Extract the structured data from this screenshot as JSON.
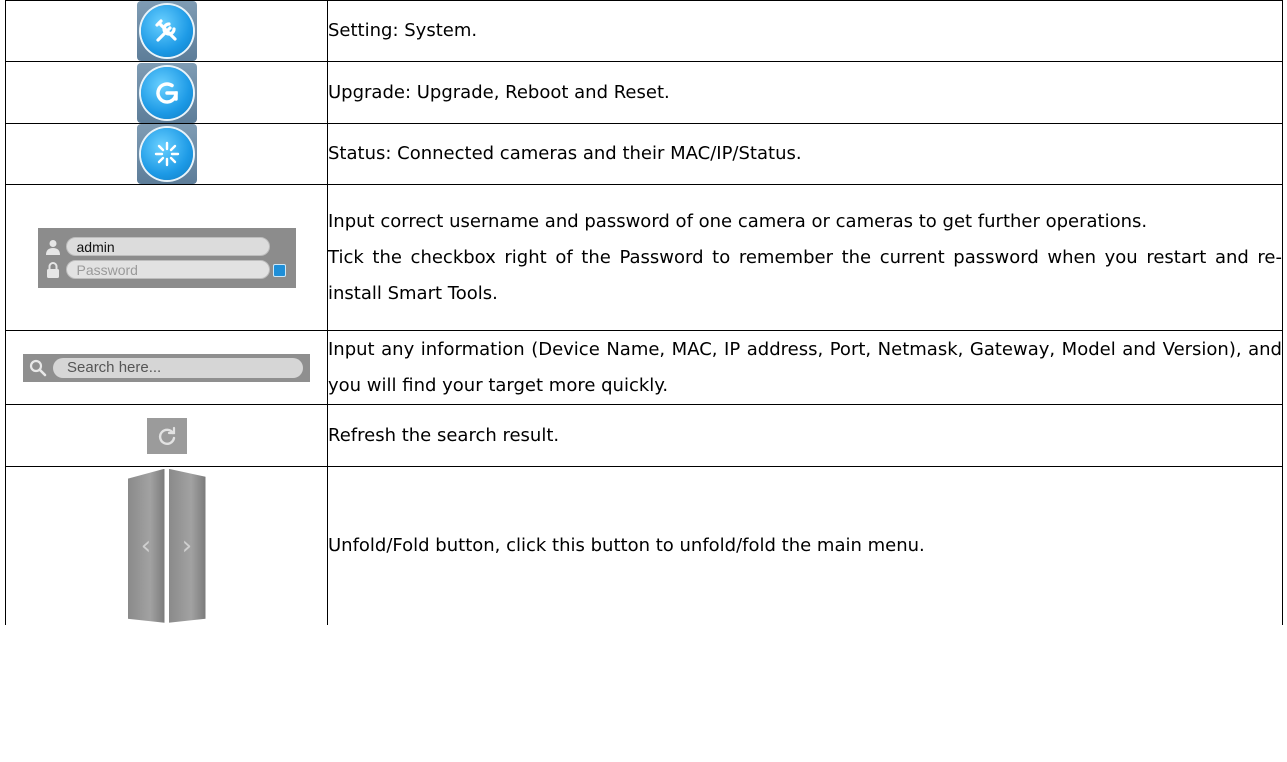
{
  "rows": [
    {
      "icon": "tools-icon",
      "text": "Setting: System."
    },
    {
      "icon": "upgrade-icon",
      "text": "Upgrade: Upgrade, Reboot and Reset."
    },
    {
      "icon": "status-icon",
      "text": "Status: Connected cameras and their MAC/IP/Status."
    },
    {
      "icon": "login-widget",
      "username_value": "admin",
      "password_placeholder": "Password",
      "text_line1": "Input correct username and password of one camera or cameras to get further operations.",
      "text_line2": "Tick the checkbox right of the Password to remember the current password when you restart and re-install Smart Tools."
    },
    {
      "icon": "search-widget",
      "search_placeholder": "Search here...",
      "text": "Input any information (Device Name, MAC, IP address, Port, Netmask, Gateway, Model and Version), and you will find your target more quickly."
    },
    {
      "icon": "refresh-icon",
      "text": "Refresh the search result."
    },
    {
      "icon": "fold-buttons",
      "left_glyph": "‹",
      "right_glyph": "›",
      "text": "Unfold/Fold button, click this button to unfold/fold the main menu."
    }
  ],
  "colors": {
    "icon_blue": "#1d9ae6",
    "widget_gray": "#8c8c8c",
    "checkbox_blue": "#1f8fd8"
  }
}
